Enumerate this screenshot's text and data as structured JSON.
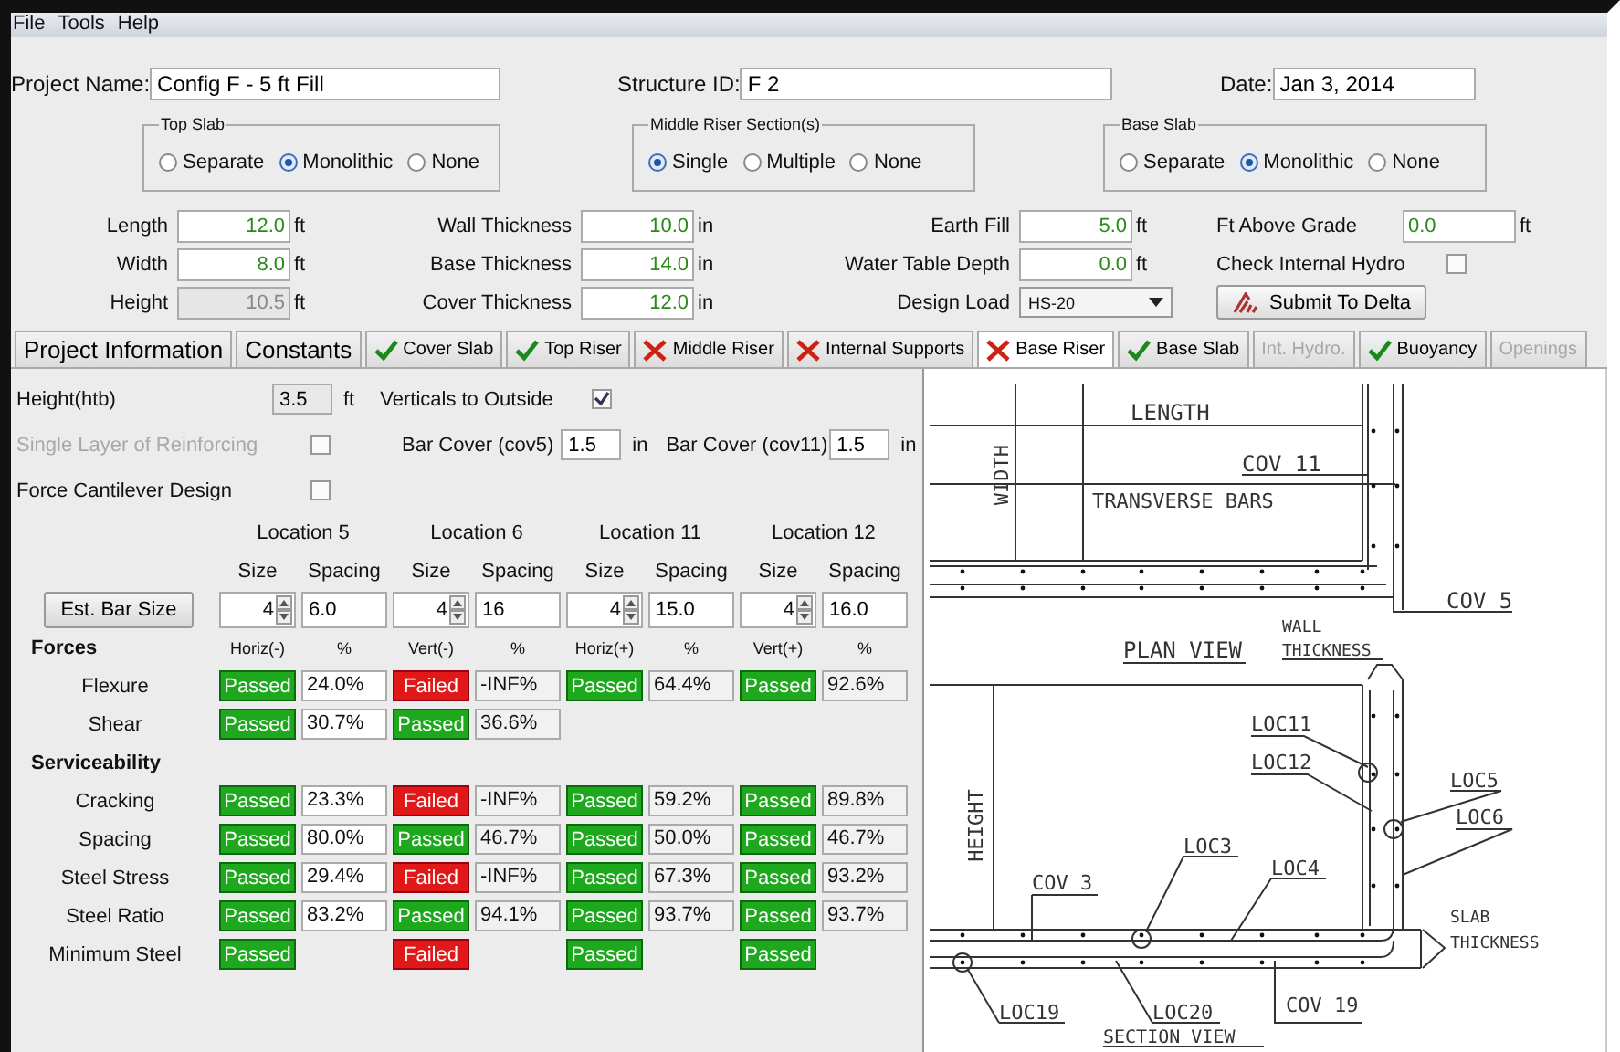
{
  "menu": [
    {
      "label": "File"
    },
    {
      "label": "Tools"
    },
    {
      "label": "Help"
    }
  ],
  "header_fields": [
    {
      "label": "Project Name:",
      "value": "Config F - 5 ft Fill"
    },
    {
      "label": "Structure ID:",
      "value": "F 2"
    },
    {
      "label": "Date:",
      "value": "Jan 3, 2014"
    }
  ],
  "radio_groups": [
    {
      "title": "Top Slab",
      "options": [
        {
          "label": "Separate",
          "selected": false
        },
        {
          "label": "Monolithic",
          "selected": true
        },
        {
          "label": "None",
          "selected": false
        }
      ]
    },
    {
      "title": "Middle Riser Section(s)",
      "options": [
        {
          "label": "Single",
          "selected": true
        },
        {
          "label": "Multiple",
          "selected": false
        },
        {
          "label": "None",
          "selected": false
        }
      ]
    },
    {
      "title": "Base Slab",
      "options": [
        {
          "label": "Separate",
          "selected": false
        },
        {
          "label": "Monolithic",
          "selected": true
        },
        {
          "label": "None",
          "selected": false
        }
      ]
    }
  ],
  "dimension_columns": [
    [
      {
        "kind": "field",
        "label": "Length",
        "value": "12.0",
        "unit": "ft",
        "disabled": false
      },
      {
        "kind": "field",
        "label": "Width",
        "value": "8.0",
        "unit": "ft",
        "disabled": false
      },
      {
        "kind": "field",
        "label": "Height",
        "value": "10.5",
        "unit": "ft",
        "disabled": true
      }
    ],
    [
      {
        "kind": "field",
        "label": "Wall Thickness",
        "value": "10.0",
        "unit": "in",
        "disabled": false
      },
      {
        "kind": "field",
        "label": "Base Thickness",
        "value": "14.0",
        "unit": "in",
        "disabled": false
      },
      {
        "kind": "field",
        "label": "Cover Thickness",
        "value": "12.0",
        "unit": "in",
        "disabled": false
      }
    ],
    [
      {
        "kind": "field",
        "label": "Earth Fill",
        "value": "5.0",
        "unit": "ft",
        "disabled": false
      },
      {
        "kind": "field",
        "label": "Water Table Depth",
        "value": "0.0",
        "unit": "ft",
        "disabled": false
      },
      {
        "kind": "select",
        "label": "Design Load",
        "value": "HS-20"
      }
    ],
    [
      {
        "kind": "field",
        "label": "Ft Above Grade",
        "value": "0.0",
        "unit": "ft",
        "disabled": false
      },
      {
        "kind": "checkbox",
        "label": "Check Internal Hydro",
        "checked": false
      },
      {
        "kind": "button",
        "label": "Submit To Delta"
      }
    ]
  ],
  "tabs": [
    {
      "label": "Project Information",
      "kind": "plain",
      "selected": false,
      "disabled": false
    },
    {
      "label": "Constants",
      "kind": "plain",
      "selected": false,
      "disabled": false
    },
    {
      "label": "Cover Slab",
      "kind": "pass",
      "selected": false,
      "disabled": false
    },
    {
      "label": "Top Riser",
      "kind": "pass",
      "selected": false,
      "disabled": false
    },
    {
      "label": "Middle Riser",
      "kind": "fail",
      "selected": false,
      "disabled": false
    },
    {
      "label": "Internal Supports",
      "kind": "fail",
      "selected": false,
      "disabled": false
    },
    {
      "label": "Base Riser",
      "kind": "fail",
      "selected": true,
      "disabled": false
    },
    {
      "label": "Base Slab",
      "kind": "pass",
      "selected": false,
      "disabled": false
    },
    {
      "label": "Int. Hydro.",
      "kind": "plain",
      "selected": false,
      "disabled": true
    },
    {
      "label": "Buoyancy",
      "kind": "pass",
      "selected": false,
      "disabled": false
    },
    {
      "label": "Openings",
      "kind": "plain",
      "selected": false,
      "disabled": true
    }
  ],
  "base_riser": {
    "height": {
      "label": "Height(htb)",
      "value": "3.5",
      "unit": "ft"
    },
    "verticals": {
      "label": "Verticals to Outside",
      "checked": true
    },
    "single_layer": {
      "label": "Single Layer of Reinforcing",
      "checked": false,
      "disabled": true
    },
    "bar_covers": [
      {
        "label": "Bar Cover (cov5)",
        "value": "1.5",
        "unit": "in"
      },
      {
        "label": "Bar Cover (cov11)",
        "value": "1.5",
        "unit": "in"
      }
    ],
    "force_cantilever": {
      "label": "Force Cantilever Design",
      "checked": false
    },
    "est_button": "Est. Bar Size",
    "locations": [
      {
        "title": "Location 5",
        "size_label": "Size",
        "spacing_label": "Spacing",
        "size": "4",
        "spacing": "6.0",
        "direction": "Horiz(-)",
        "percent_label": "%"
      },
      {
        "title": "Location 6",
        "size_label": "Size",
        "spacing_label": "Spacing",
        "size": "4",
        "spacing": "16",
        "direction": "Vert(-)",
        "percent_label": "%"
      },
      {
        "title": "Location 11",
        "size_label": "Size",
        "spacing_label": "Spacing",
        "size": "4",
        "spacing": "15.0",
        "direction": "Horiz(+)",
        "percent_label": "%"
      },
      {
        "title": "Location 12",
        "size_label": "Size",
        "spacing_label": "Spacing",
        "size": "4",
        "spacing": "16.0",
        "direction": "Vert(+)",
        "percent_label": "%"
      }
    ],
    "sections": [
      {
        "title": "Forces",
        "rows": [
          {
            "label": "Flexure",
            "results": [
              {
                "kind": "pass",
                "text": "Passed",
                "percent": "24.0%"
              },
              {
                "kind": "fail",
                "text": "Failed",
                "percent": "-INF%"
              },
              {
                "kind": "pass",
                "text": "Passed",
                "percent": "64.4%"
              },
              {
                "kind": "pass",
                "text": "Passed",
                "percent": "92.6%"
              }
            ]
          },
          {
            "label": "Shear",
            "results": [
              {
                "kind": "pass",
                "text": "Passed",
                "percent": "30.7%"
              },
              {
                "kind": "pass",
                "text": "Passed",
                "percent": "36.6%"
              }
            ]
          }
        ]
      },
      {
        "title": "Serviceability",
        "rows": [
          {
            "label": "Cracking",
            "results": [
              {
                "kind": "pass",
                "text": "Passed",
                "percent": "23.3%"
              },
              {
                "kind": "fail",
                "text": "Failed",
                "percent": "-INF%"
              },
              {
                "kind": "pass",
                "text": "Passed",
                "percent": "59.2%"
              },
              {
                "kind": "pass",
                "text": "Passed",
                "percent": "89.8%"
              }
            ]
          },
          {
            "label": "Spacing",
            "results": [
              {
                "kind": "pass",
                "text": "Passed",
                "percent": "80.0%"
              },
              {
                "kind": "pass",
                "text": "Passed",
                "percent": "46.7%"
              },
              {
                "kind": "pass",
                "text": "Passed",
                "percent": "50.0%"
              },
              {
                "kind": "pass",
                "text": "Passed",
                "percent": "46.7%"
              }
            ]
          },
          {
            "label": "Steel Stress",
            "results": [
              {
                "kind": "pass",
                "text": "Passed",
                "percent": "29.4%"
              },
              {
                "kind": "fail",
                "text": "Failed",
                "percent": "-INF%"
              },
              {
                "kind": "pass",
                "text": "Passed",
                "percent": "67.3%"
              },
              {
                "kind": "pass",
                "text": "Passed",
                "percent": "93.2%"
              }
            ]
          },
          {
            "label": "Steel Ratio",
            "results": [
              {
                "kind": "pass",
                "text": "Passed",
                "percent": "83.2%"
              },
              {
                "kind": "pass",
                "text": "Passed",
                "percent": "94.1%"
              },
              {
                "kind": "pass",
                "text": "Passed",
                "percent": "93.7%"
              },
              {
                "kind": "pass",
                "text": "Passed",
                "percent": "93.7%"
              }
            ]
          },
          {
            "label": "Minimum Steel",
            "results": [
              {
                "kind": "pass",
                "text": "Passed"
              },
              {
                "kind": "fail",
                "text": "Failed"
              },
              {
                "kind": "pass",
                "text": "Passed"
              },
              {
                "kind": "pass",
                "text": "Passed"
              }
            ]
          }
        ]
      }
    ]
  },
  "drawing": {
    "labels": [
      "LENGTH",
      "WIDTH",
      "COV 11",
      "TRANSVERSE BARS",
      "COV 5",
      "WALL",
      "THICKNESS",
      "PLAN VIEW",
      "LOC11",
      "LOC12",
      "LOC5",
      "LOC6",
      "HEIGHT",
      "LOC3",
      "LOC4",
      "COV 3",
      "SLAB",
      "THICKNESS",
      "LOC19",
      "LOC20",
      "COV 19",
      "SECTION VIEW"
    ]
  }
}
